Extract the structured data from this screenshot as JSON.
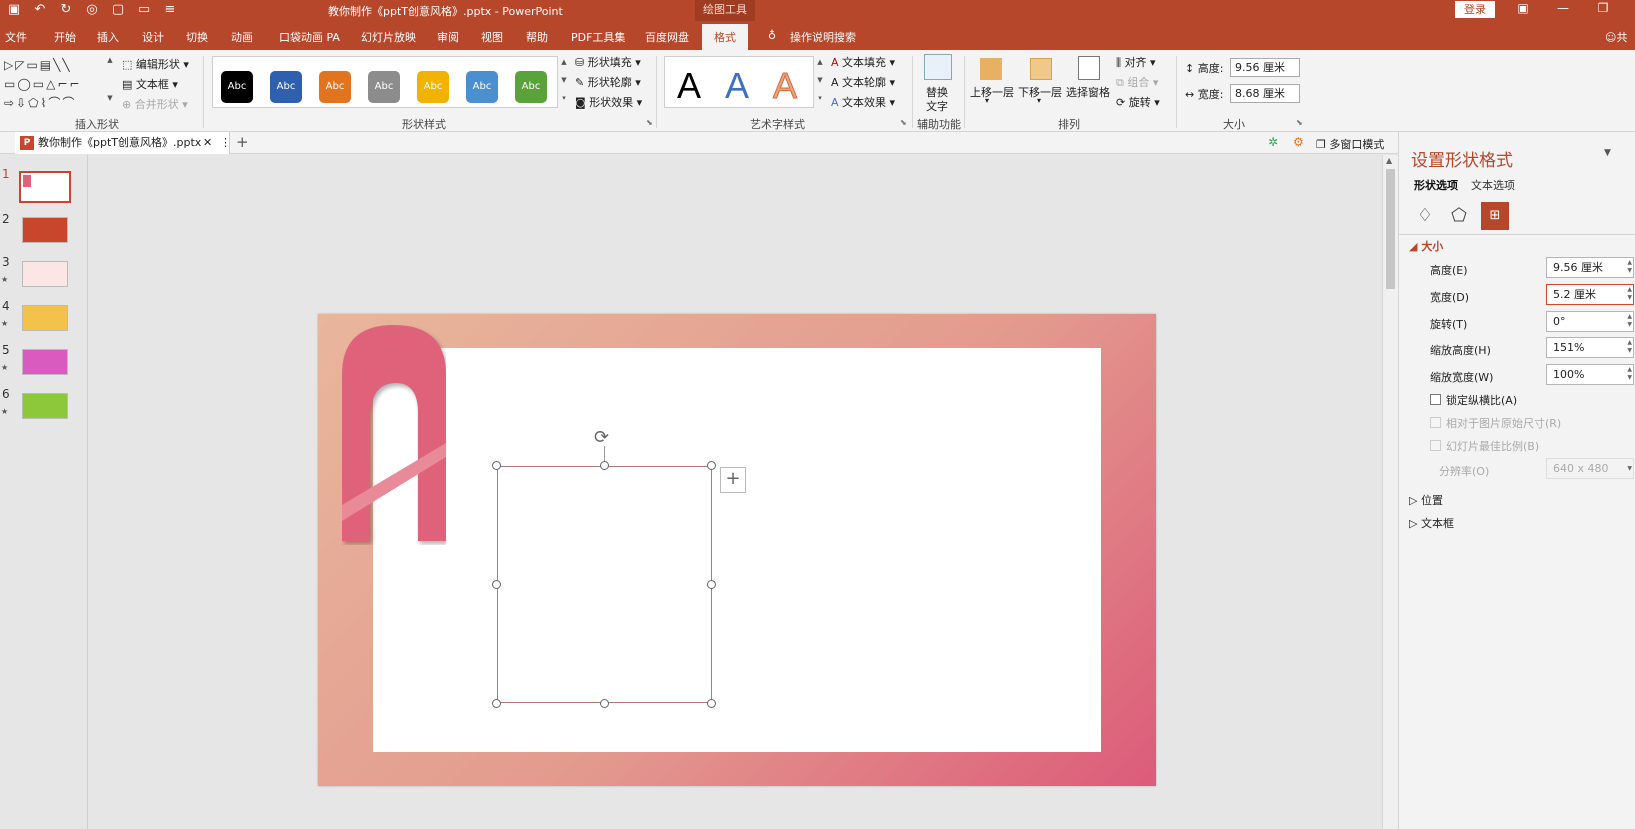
{
  "window": {
    "doc_title": "教你制作《pptT创意风格》.pptx  -  PowerPoint",
    "context_tool": "绘图工具",
    "login": "登录"
  },
  "tabs": [
    "文件",
    "开始",
    "插入",
    "设计",
    "切换",
    "动画",
    "口袋动画 PA",
    "幻灯片放映",
    "审阅",
    "视图",
    "帮助",
    "PDF工具集",
    "百度网盘",
    "格式"
  ],
  "active_tab": "格式",
  "tell_me": "操作说明搜索",
  "share": "共",
  "ribbon": {
    "insert_shapes": {
      "label": "插入形状",
      "edit_shape": "编辑形状",
      "text_box": "文本框",
      "merge_shapes": "合并形状"
    },
    "shape_styles": {
      "label": "形状样式",
      "chip_text": "Abc",
      "chip_colors": [
        "#000000",
        "#2f5faf",
        "#e2741f",
        "#8c8c8c",
        "#f2b200",
        "#4a8fd0",
        "#5aa23a"
      ],
      "fill": "形状填充",
      "outline": "形状轮廓",
      "effects": "形状效果"
    },
    "wordart": {
      "label": "艺术字样式",
      "letter": "A",
      "text_fill": "文本填充",
      "text_outline": "文本轮廓",
      "text_effects": "文本效果"
    },
    "accessibility": {
      "label": "辅助功能",
      "alt_text_1": "替换",
      "alt_text_2": "文字"
    },
    "arrange": {
      "label": "排列",
      "bring_forward": "上移一层",
      "send_backward": "下移一层",
      "selection_pane": "选择窗格",
      "align": "对齐",
      "group": "组合",
      "rotate": "旋转"
    },
    "size": {
      "label": "大小",
      "height_label": "高度:",
      "height_value": "9.56 厘米",
      "width_label": "宽度:",
      "width_value": "8.68 厘米"
    }
  },
  "doc_tab": {
    "name": "教你制作《pptT创意风格》.pptx",
    "close": "✕",
    "more": "⋮",
    "add": "+"
  },
  "view_mode": "多窗口模式",
  "slides": [
    {
      "number": "1",
      "star": ""
    },
    {
      "number": "2",
      "star": ""
    },
    {
      "number": "3",
      "star": "★"
    },
    {
      "number": "4",
      "star": "★"
    },
    {
      "number": "5",
      "star": "★"
    },
    {
      "number": "6",
      "star": "★"
    }
  ],
  "format_pane": {
    "title": "设置形状格式",
    "tab_shape": "形状选项",
    "tab_text": "文本选项",
    "section_size": "大小",
    "height_label": "高度(E)",
    "height_value": "9.56 厘米",
    "width_label": "宽度(D)",
    "width_value": "5.2 厘米",
    "rotation_label": "旋转(T)",
    "rotation_value": "0°",
    "scale_height_label": "缩放高度(H)",
    "scale_height_value": "151%",
    "scale_width_label": "缩放宽度(W)",
    "scale_width_value": "100%",
    "lock_aspect": "锁定纵横比(A)",
    "relative_original": "相对于图片原始尺寸(R)",
    "best_scale": "幻灯片最佳比例(B)",
    "resolution_label": "分辨率(O)",
    "resolution_value": "640 x 480",
    "section_position": "位置",
    "section_textbox": "文本框"
  },
  "colors": {
    "accent": "#b7472a",
    "slide_grad_start": "#e8b69c",
    "slide_grad_end": "#dc5b79",
    "letter": "#e0617a"
  }
}
